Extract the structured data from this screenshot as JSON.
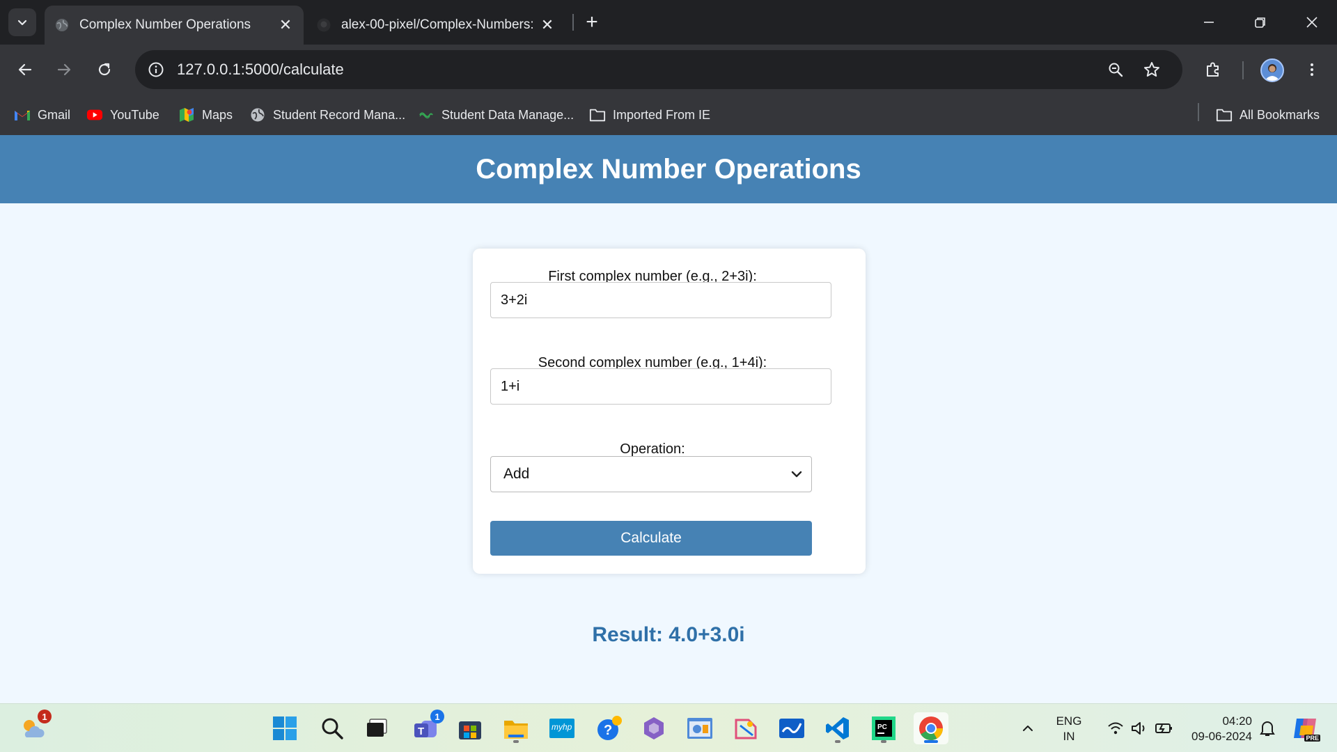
{
  "browser": {
    "tabs": [
      {
        "title": "Complex Number Operations",
        "active": true
      },
      {
        "title": "alex-00-pixel/Complex-Numbers: /",
        "active": false
      }
    ],
    "url": "127.0.0.1:5000/calculate",
    "bookmarks": [
      {
        "label": "Gmail",
        "icon": "gmail-icon"
      },
      {
        "label": "YouTube",
        "icon": "youtube-icon"
      },
      {
        "label": "Maps",
        "icon": "maps-icon"
      },
      {
        "label": "Student Record Mana...",
        "icon": "globe-icon"
      },
      {
        "label": "Student Data Manage...",
        "icon": "link-icon"
      },
      {
        "label": "Imported From IE",
        "icon": "folder-icon"
      }
    ],
    "all_bookmarks_label": "All Bookmarks"
  },
  "page": {
    "title": "Complex Number Operations",
    "form": {
      "first_label": "First complex number (e.g., 2+3i):",
      "first_value": "3+2i",
      "second_label": "Second complex number (e.g., 1+4i):",
      "second_value": "1+i",
      "operation_label": "Operation:",
      "operation_value": "Add",
      "submit_label": "Calculate"
    },
    "result": "Result: 4.0+3.0i"
  },
  "taskbar": {
    "weather_badge": "1",
    "teams_badge": "1",
    "myhp_label": "myhp",
    "language": "ENG",
    "region": "IN",
    "time": "04:20",
    "date": "09-06-2024",
    "copilot_label": "PRE"
  },
  "colors": {
    "header": "#4682b4",
    "page_bg": "#f0f8ff",
    "result_text": "#2f70a8"
  }
}
